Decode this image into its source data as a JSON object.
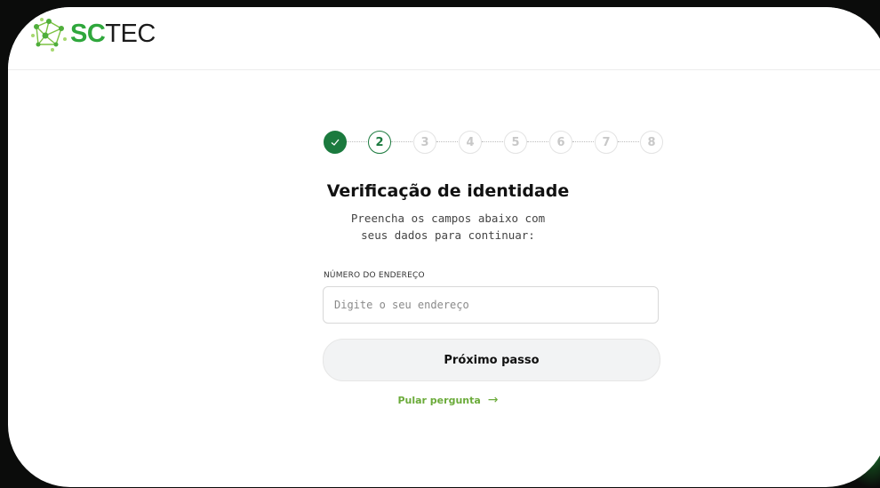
{
  "brand": {
    "name_part1": "SC",
    "name_part2": "TEC",
    "accent_green": "#2fa73c",
    "primary_green": "#1b7a3e",
    "link_green": "#6bab3a"
  },
  "stepper": {
    "steps": [
      {
        "label": "",
        "state": "done",
        "icon": "check-icon"
      },
      {
        "label": "2",
        "state": "current"
      },
      {
        "label": "3",
        "state": "pending"
      },
      {
        "label": "4",
        "state": "pending"
      },
      {
        "label": "5",
        "state": "pending"
      },
      {
        "label": "6",
        "state": "pending"
      },
      {
        "label": "7",
        "state": "pending"
      },
      {
        "label": "8",
        "state": "pending"
      }
    ]
  },
  "form": {
    "title": "Verificação de identidade",
    "subtitle_line1": "Preencha os campos abaixo com",
    "subtitle_line2": "seus dados para continuar:",
    "field_label": "NÚMERO DO ENDEREÇO",
    "field_placeholder": "Digite o seu endereço",
    "field_value": "",
    "next_button": "Próximo passo",
    "skip_link": "Pular pergunta",
    "skip_icon": "arrow-right-icon"
  }
}
